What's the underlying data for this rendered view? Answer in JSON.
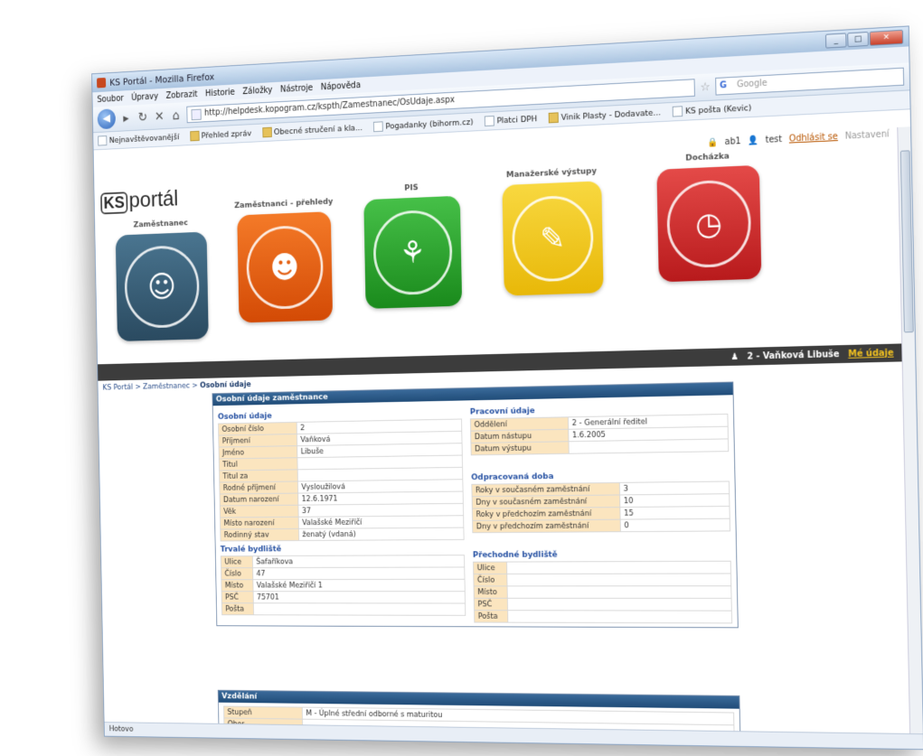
{
  "window": {
    "title": "KS Portál - Mozilla Firefox"
  },
  "menu": [
    "Soubor",
    "Úpravy",
    "Zobrazit",
    "Historie",
    "Záložky",
    "Nástroje",
    "Nápověda"
  ],
  "nav": {
    "url": "http://helpdesk.kopogram.cz/kspth/Zamestnanec/OsUdaje.aspx",
    "search_placeholder": "Google"
  },
  "bookmarks": [
    "Nejnavštěvovanější",
    "Přehled zpráv",
    "Obecné stručení a kla...",
    "Pogadanky (bihorm.cz)",
    "Platci DPH",
    "Vinik Plasty - Dodavate...",
    "KS pošta (Kevic)"
  ],
  "user_line": {
    "user1": "ab1",
    "user2": "test",
    "logout": "Odhlásit se",
    "settings": "Nastavení"
  },
  "logo": {
    "text": "portál",
    "mark": "KS"
  },
  "tiles": [
    {
      "label": "Zaměstnanec",
      "color": "#365a72"
    },
    {
      "label": "Zaměstnanci - přehledy",
      "color": "#ea5a12"
    },
    {
      "label": "PIS",
      "color": "#2aa02a"
    },
    {
      "label": "Manažerské výstupy",
      "color": "#f1c412"
    },
    {
      "label": "Docházka",
      "color": "#d1282c"
    }
  ],
  "current_user": {
    "name": "2 - Vaňková Libuše",
    "my_data": "Mé údaje"
  },
  "breadcrumb": {
    "items": [
      "KS Portál",
      "Zaměstnanec"
    ],
    "current": "Osobní údaje"
  },
  "main_panel": {
    "title": "Osobní údaje zaměstnance",
    "personal": {
      "title": "Osobní údaje",
      "rows": [
        {
          "k": "Osobní číslo",
          "v": "2"
        },
        {
          "k": "Příjmení",
          "v": "Vaňková"
        },
        {
          "k": "Jméno",
          "v": "Libuše"
        },
        {
          "k": "Titul",
          "v": ""
        },
        {
          "k": "Titul za",
          "v": ""
        },
        {
          "k": "Rodné příjmení",
          "v": "Vysloužilová"
        },
        {
          "k": "Datum narození",
          "v": "12.6.1971"
        },
        {
          "k": "Věk",
          "v": "37"
        },
        {
          "k": "Místo narození",
          "v": "Valašské Meziříčí"
        },
        {
          "k": "Rodinný stav",
          "v": "ženatý (vdaná)"
        }
      ]
    },
    "work": {
      "title": "Pracovní údaje",
      "rows": [
        {
          "k": "Oddělení",
          "v": "2 - Generální ředitel"
        },
        {
          "k": "Datum nástupu",
          "v": "1.6.2005"
        },
        {
          "k": "Datum výstupu",
          "v": ""
        }
      ]
    },
    "worked": {
      "title": "Odpracovaná doba",
      "rows": [
        {
          "k": "Roky v současném zaměstnání",
          "v": "3"
        },
        {
          "k": "Dny v současném zaměstnání",
          "v": "10"
        },
        {
          "k": "Roky v předchozím zaměstnání",
          "v": "15"
        },
        {
          "k": "Dny v předchozím zaměstnání",
          "v": "0"
        }
      ]
    },
    "permanent": {
      "title": "Trvalé bydliště",
      "rows": [
        {
          "k": "Ulice",
          "v": "Šafaříkova"
        },
        {
          "k": "Číslo",
          "v": "47"
        },
        {
          "k": "Místo",
          "v": "Valašské Meziříčí 1"
        },
        {
          "k": "PSČ",
          "v": "75701"
        },
        {
          "k": "Pošta",
          "v": ""
        }
      ]
    },
    "temporary": {
      "title": "Přechodné bydliště",
      "rows": [
        {
          "k": "Ulice",
          "v": ""
        },
        {
          "k": "Číslo",
          "v": ""
        },
        {
          "k": "Místo",
          "v": ""
        },
        {
          "k": "PSČ",
          "v": ""
        },
        {
          "k": "Pošta",
          "v": ""
        }
      ]
    }
  },
  "education_panel": {
    "title": "Vzdělání",
    "rows": [
      {
        "k": "Stupeň",
        "v": "M - Úplné střední odborné s maturitou"
      },
      {
        "k": "Obor",
        "v": ""
      }
    ]
  },
  "status": "Hotovo",
  "bg_fragment": "n"
}
